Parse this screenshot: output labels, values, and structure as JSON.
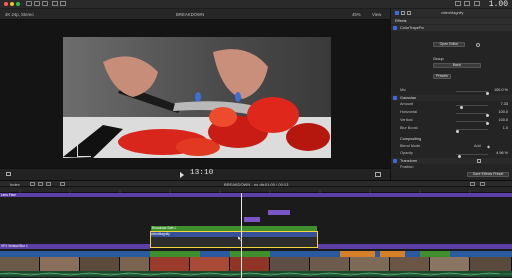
{
  "window": {
    "time_display": "1.00"
  },
  "viewer_bar": {
    "format": "4K 24p, Stereo",
    "title": "BREAKDOWN",
    "zoom": "45%",
    "view_menu": "View"
  },
  "transport": {
    "timecode": "13:10"
  },
  "inspector": {
    "clip_name": "videoMagnify",
    "effects_header": "Effects",
    "effect_name": "ColorTrapeFix",
    "open_editor": "Open Editor",
    "group_label": "Group",
    "group_value": "Basic",
    "presets": "Presets",
    "mix_label": "Mix",
    "mix_value": "100.0 %",
    "gaussian_label": "Gaussian",
    "amount_label": "Amount",
    "amount_value": "7.33",
    "horizontal_label": "Horizontal",
    "horizontal_value": "100.0",
    "vertical_label": "Vertical",
    "vertical_value": "100.0",
    "blur_boost_label": "Blur Boost",
    "blur_boost_value": "1.0",
    "compositing_label": "Compositing",
    "blend_mode_label": "Blend Mode",
    "blend_mode_value": "Add",
    "opacity_label": "Opacity",
    "opacity_value": "4.96 %",
    "transform_label": "Transform",
    "position_label": "Position",
    "save_preset": "Save Effects Preset"
  },
  "timeline_toolbar": {
    "index": "Index",
    "project": "BREAKDOWN - no dis",
    "duration": "01:00 / 00:13"
  },
  "timeline": {
    "clips": {
      "top_bar": "Lens Flare",
      "title_purple_a": "",
      "title_purple_b": "",
      "green_clip": "Broadcast Safe L",
      "selected_clip": "videoMagnify",
      "purple_left": "VFX Vertical Blur 1",
      "purple_right": "",
      "primary": "",
      "orange_a": "",
      "orange_b": ""
    }
  }
}
